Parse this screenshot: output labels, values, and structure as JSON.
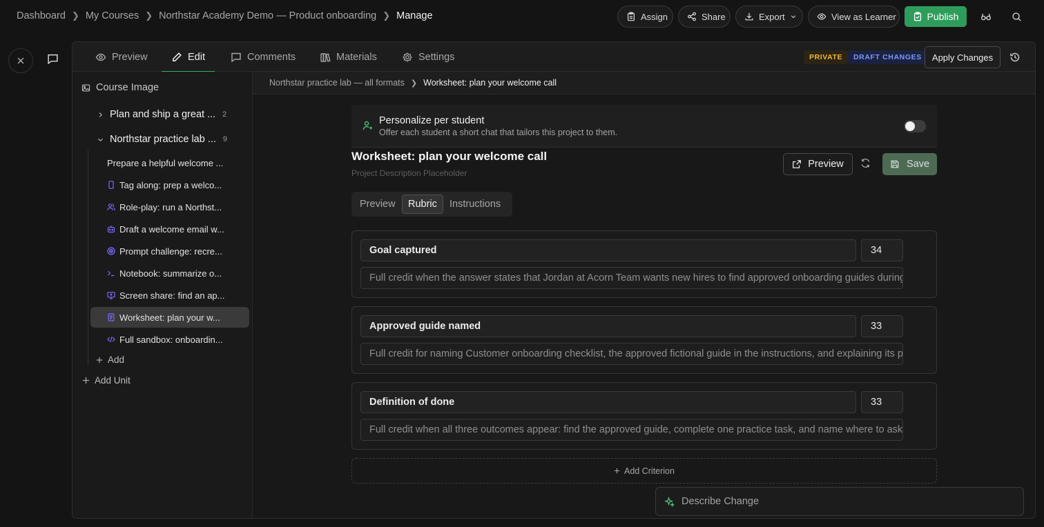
{
  "breadcrumb": [
    "Dashboard",
    "My Courses",
    "Northstar Academy Demo — Product onboarding",
    "Manage"
  ],
  "topbar": {
    "assign": "Assign",
    "share": "Share",
    "export": "Export",
    "view_as_learner": "View as Learner",
    "publish": "Publish"
  },
  "tabs": {
    "preview": "Preview",
    "edit": "Edit",
    "comments": "Comments",
    "materials": "Materials",
    "settings": "Settings"
  },
  "badges": {
    "private": "PRIVATE",
    "draft": "DRAFT CHANGES",
    "private_color": "#f0b93b",
    "draft_color": "#6b8cff"
  },
  "apply_changes": "Apply Changes",
  "sidebar": {
    "course_image": "Course Image",
    "units": [
      {
        "title": "Plan and ship a great ...",
        "count": "2",
        "expanded": false
      },
      {
        "title": "Northstar practice lab ...",
        "count": "9",
        "expanded": true
      }
    ],
    "items": [
      {
        "label": "Prepare a helpful welcome ...",
        "icon": "none"
      },
      {
        "label": "Tag along: prep a welco...",
        "icon": "phone-icon"
      },
      {
        "label": "Role-play: run a Northst...",
        "icon": "users-icon"
      },
      {
        "label": "Draft a welcome email w...",
        "icon": "bot-icon"
      },
      {
        "label": "Prompt challenge: recre...",
        "icon": "target-icon"
      },
      {
        "label": "Notebook: summarize o...",
        "icon": "terminal-icon"
      },
      {
        "label": "Screen share: find an ap...",
        "icon": "screen-icon"
      },
      {
        "label": "Worksheet: plan your w...",
        "icon": "worksheet-icon"
      },
      {
        "label": "Full sandbox: onboardin...",
        "icon": "code-icon"
      }
    ],
    "add": "Add",
    "add_unit": "Add Unit"
  },
  "main": {
    "breadcrumb": [
      "Northstar practice lab — all formats",
      "Worksheet: plan your welcome call"
    ],
    "personalize": {
      "title": "Personalize per student",
      "subtitle": "Offer each student a short chat that tailors this project to them.",
      "enabled": false
    },
    "title": "Worksheet: plan your welcome call",
    "description_placeholder": "Project Description Placeholder",
    "preview_button": "Preview",
    "save_button": "Save",
    "subtabs": [
      "Preview",
      "Rubric",
      "Instructions"
    ],
    "active_subtab": "Rubric",
    "criteria": [
      {
        "name": "Goal captured",
        "points": "34",
        "description": "Full credit when the answer states that Jordan at Acorn Team wants new hires to find approved onboarding guides during their first week"
      },
      {
        "name": "Approved guide named",
        "points": "33",
        "description": "Full credit for naming Customer onboarding checklist, the approved fictional guide in the instructions, and explaining its purpose"
      },
      {
        "name": "Definition of done",
        "points": "33",
        "description": "Full credit when all three outcomes appear: find the approved guide, complete one practice task, and name where to ask for help"
      }
    ],
    "add_criterion": "Add Criterion",
    "describe_change": "Describe Change"
  }
}
